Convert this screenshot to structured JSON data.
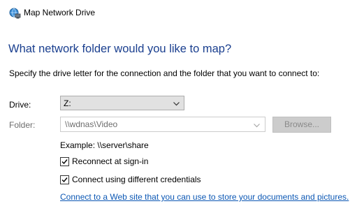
{
  "window": {
    "title": "Map Network Drive",
    "icon": "network-drive-icon"
  },
  "main": {
    "heading": "What network folder would you like to map?",
    "instructions": "Specify the drive letter for the connection and the folder that you want to connect to:",
    "drive": {
      "label": "Drive:",
      "value": "Z:"
    },
    "folder": {
      "label": "Folder:",
      "value": "\\\\wdnas\\Video",
      "browse_label": "Browse..."
    },
    "example": "Example: \\\\server\\share",
    "reconnect": {
      "label": "Reconnect at sign-in",
      "checked": true
    },
    "credentials": {
      "label": "Connect using different credentials",
      "checked": true
    },
    "link": "Connect to a Web site that you can use to store your documents and pictures."
  },
  "colors": {
    "heading": "#1a3f8f",
    "link": "#0b57b4",
    "disabled_text": "#8a8a8a"
  }
}
